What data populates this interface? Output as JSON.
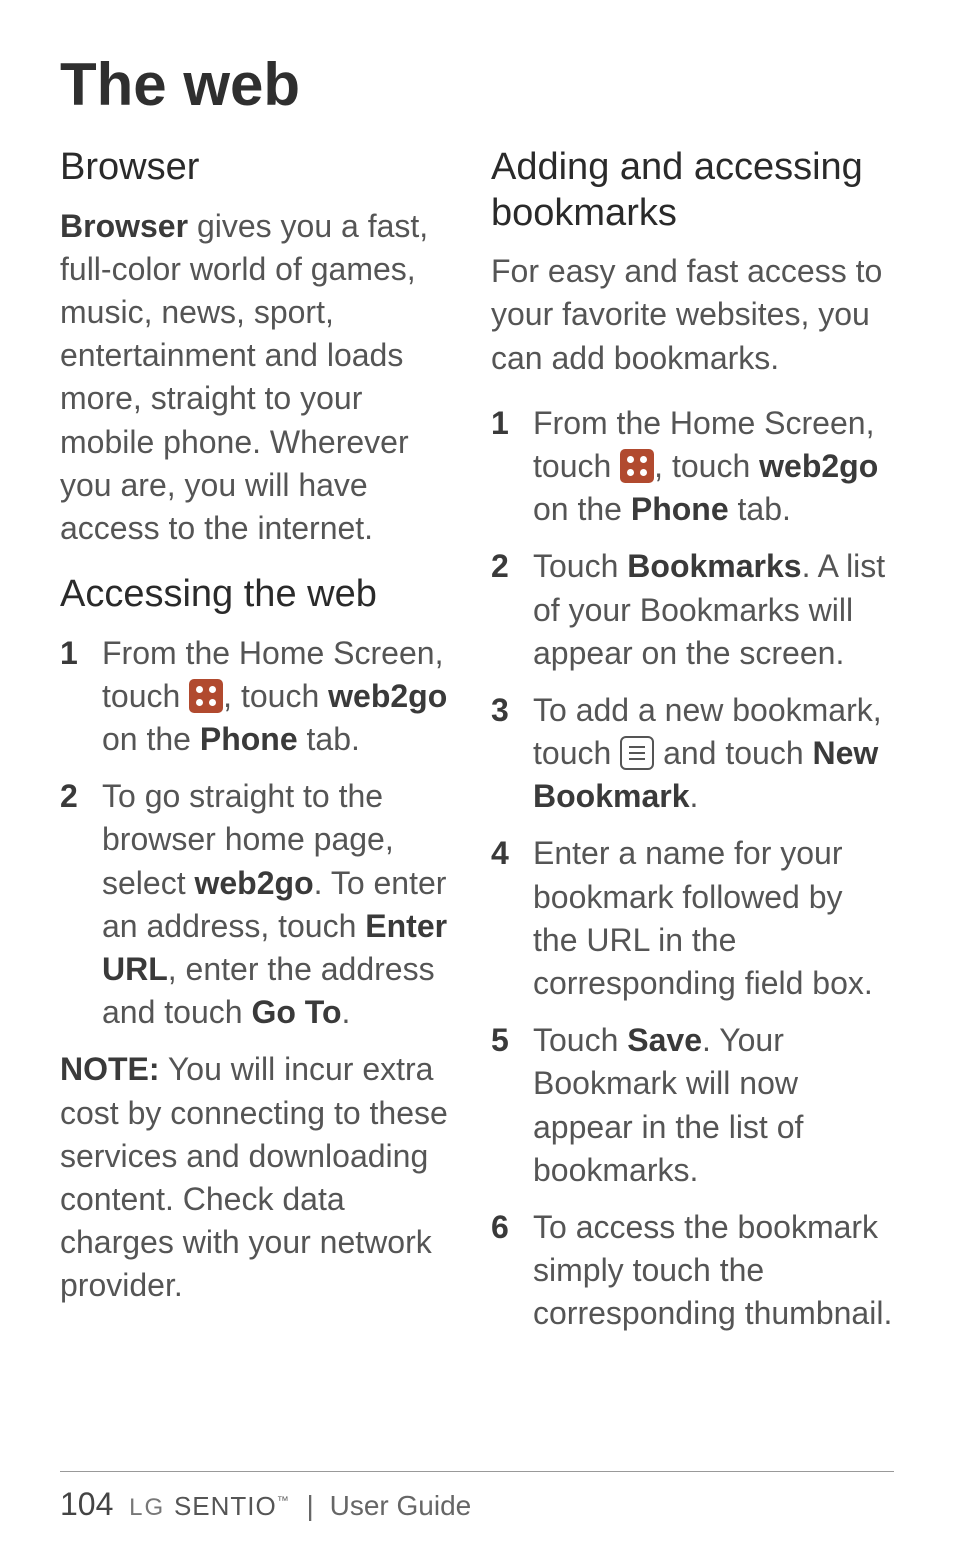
{
  "title": "The web",
  "left": {
    "h_browser": "Browser",
    "p_browser_1": " gives you a fast, full-color world of games, music, news, sport, entertainment and loads more, straight to your mobile phone. Wherever you are, you will have access to the internet.",
    "p_browser_lead": "Browser",
    "h_access": "Accessing the web",
    "step1_a": "From the Home Screen, touch ",
    "step1_b": ", touch ",
    "step1_c": "web2go",
    "step1_d": " on the ",
    "step1_e": "Phone",
    "step1_f": " tab.",
    "step2_a": "To go straight to the browser home page, select ",
    "step2_b": "web2go",
    "step2_c": ". To enter an address, touch ",
    "step2_d": "Enter URL",
    "step2_e": ", enter the address and touch ",
    "step2_f": "Go To",
    "step2_g": ".",
    "note_label": "NOTE:",
    "note_text": " You will incur extra cost by connecting to these services and downloading content. Check data charges with your network provider."
  },
  "right": {
    "h_book": "Adding and accessing bookmarks",
    "p_book": "For easy and fast access to your favorite websites, you can add bookmarks.",
    "s1_a": "From the Home Screen, touch ",
    "s1_b": ", touch ",
    "s1_c": "web2go",
    "s1_d": " on the ",
    "s1_e": "Phone",
    "s1_f": " tab.",
    "s2_a": "Touch ",
    "s2_b": "Bookmarks",
    "s2_c": ". A list of your Bookmarks will appear on the screen.",
    "s3_a": "To add a new bookmark, touch ",
    "s3_b": " and touch ",
    "s3_c": "New Bookmark",
    "s3_d": ".",
    "s4": "Enter a name for your bookmark followed by the URL in the corresponding field box.",
    "s5_a": "Touch ",
    "s5_b": "Save",
    "s5_c": ". Your Bookmark will now appear in the list of bookmarks.",
    "s6": "To access the bookmark simply touch the corresponding thumbnail."
  },
  "nums": {
    "1": "1",
    "2": "2",
    "3": "3",
    "4": "4",
    "5": "5",
    "6": "6"
  },
  "footer": {
    "page": "104",
    "lg": "LG",
    "sentio": "SENTIO",
    "tm": "™",
    "sep": "|",
    "guide": "User Guide"
  }
}
